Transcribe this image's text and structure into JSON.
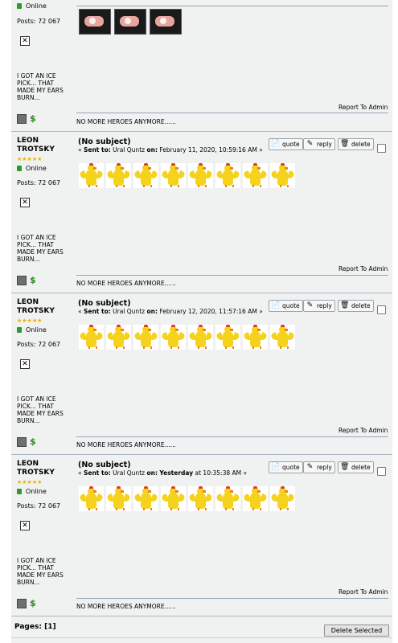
{
  "common": {
    "online": "Online",
    "posts": "Posts: 72 067",
    "blurb": "I GOT AN ICE PICK... THAT MADE MY EARS BURN...",
    "report": "Report To Admin",
    "signature": "NO MORE HEROES ANYMORE......",
    "quote": "quote",
    "reply": "reply",
    "delete": "delete",
    "stars": "★★★★★",
    "broken_image": "✕"
  },
  "messages": [
    {
      "author": "LEON TROTSKY",
      "subject": "(No subject)",
      "sent_prefix": "«",
      "sent_to_label": "Sent to:",
      "recipient": "Ural Quntz",
      "on_label": "on:",
      "date": "February 11, 2020, 10:59:16 AM",
      "suffix": "»"
    },
    {
      "author": "LEON TROTSKY",
      "subject": "(No subject)",
      "sent_prefix": "«",
      "sent_to_label": "Sent to:",
      "recipient": "Ural Quntz",
      "on_label": "on:",
      "date": "February 12, 2020, 11:57:16 AM",
      "suffix": "»"
    },
    {
      "author": "LEON TROTSKY",
      "subject": "(No subject)",
      "sent_prefix": "«",
      "sent_to_label": "Sent to:",
      "recipient": "Ural Quntz",
      "on_label": "on:",
      "date_bold": "Yesterday",
      "date_rest": "at 10:35:38 AM",
      "suffix": "»"
    }
  ],
  "footer": {
    "pages_label": "Pages:",
    "pages_value": "[1]",
    "delete_selected": "Delete Selected"
  }
}
